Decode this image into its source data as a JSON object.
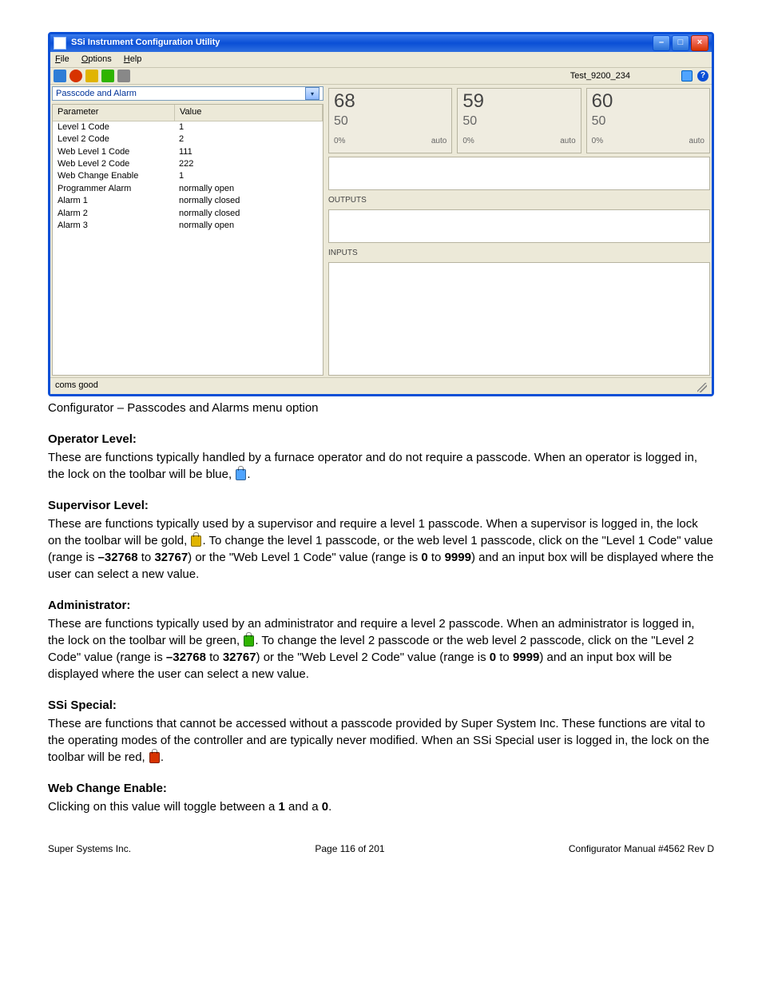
{
  "window": {
    "title": "SSi Instrument Configuration Utility",
    "menu": {
      "file": "File",
      "options": "Options",
      "help": "Help"
    },
    "device_label": "Test_9200_234",
    "dropdown": "Passcode and Alarm",
    "table_headers": {
      "param": "Parameter",
      "value": "Value"
    },
    "rows": [
      {
        "p": "Level 1 Code",
        "v": "1"
      },
      {
        "p": "Level 2 Code",
        "v": "2"
      },
      {
        "p": "Web Level 1 Code",
        "v": "111"
      },
      {
        "p": "Web Level 2 Code",
        "v": "222"
      },
      {
        "p": "Web Change Enable",
        "v": "1"
      },
      {
        "p": "Programmer Alarm",
        "v": "normally open"
      },
      {
        "p": "Alarm 1",
        "v": "normally closed"
      },
      {
        "p": "Alarm 2",
        "v": "normally closed"
      },
      {
        "p": "Alarm 3",
        "v": "normally open"
      }
    ],
    "gauges": [
      {
        "pv": "68",
        "sp": "50",
        "pct": "0%",
        "mode": "auto"
      },
      {
        "pv": "59",
        "sp": "50",
        "pct": "0%",
        "mode": "auto"
      },
      {
        "pv": "60",
        "sp": "50",
        "pct": "0%",
        "mode": "auto"
      }
    ],
    "section_outputs": "OUTPUTS",
    "section_inputs": "INPUTS",
    "status": "coms good"
  },
  "caption": "Configurator – Passcodes and Alarms menu option",
  "operator": {
    "title": "Operator Level:",
    "p1": "These are functions typically handled by a furnace operator and do not require a passcode. When an operator is logged in, the lock on the toolbar will be blue, ",
    "p2": "."
  },
  "supervisor": {
    "title": "Supervisor Level:",
    "p1": "These are functions typically used by a supervisor and require a level 1 passcode.  When a supervisor is logged in, the lock on the toolbar will be gold, ",
    "p2": ".  To change the level 1 passcode, or the web level 1 passcode, click on the \"Level 1 Code\" value (range is ",
    "r1a": "–32768",
    "p3": " to ",
    "r1b": "32767",
    "p4": ") or the \"Web Level 1 Code\" value (range is ",
    "r2a": "0",
    "p5": " to ",
    "r2b": "9999",
    "p6": ") and an input box will be displayed where the user can select a new value."
  },
  "admin": {
    "title": "Administrator:",
    "p1": "These are functions typically used by an administrator and require a level 2 passcode.  When an administrator is logged in, the lock on the toolbar will be green, ",
    "p2": ".  To change the level 2 passcode or the web level 2 passcode, click on the \"Level 2 Code\" value (range is ",
    "r1a": "–32768",
    "p3": " to ",
    "r1b": "32767",
    "p4": ") or the \"Web Level 2 Code\" value (range is ",
    "r2a": "0",
    "p5": " to ",
    "r2b": "9999",
    "p6": ") and an input box will be displayed where the user can select a new value."
  },
  "ssi": {
    "title": "SSi Special:",
    "p1": "These are functions that cannot be accessed without a passcode provided by Super System Inc.  These functions are vital to the operating modes of the controller and are typically never modified.  When an SSi Special user is logged in, the lock on the toolbar will be red, ",
    "p2": "."
  },
  "web": {
    "title": "Web Change Enable:",
    "p1": "Clicking on this value will toggle between a ",
    "v1": "1",
    "p2": " and a ",
    "v0": "0",
    "p3": "."
  },
  "footer": {
    "left": "Super Systems Inc.",
    "center": "Page 116 of 201",
    "right": "Configurator Manual #4562 Rev D"
  }
}
